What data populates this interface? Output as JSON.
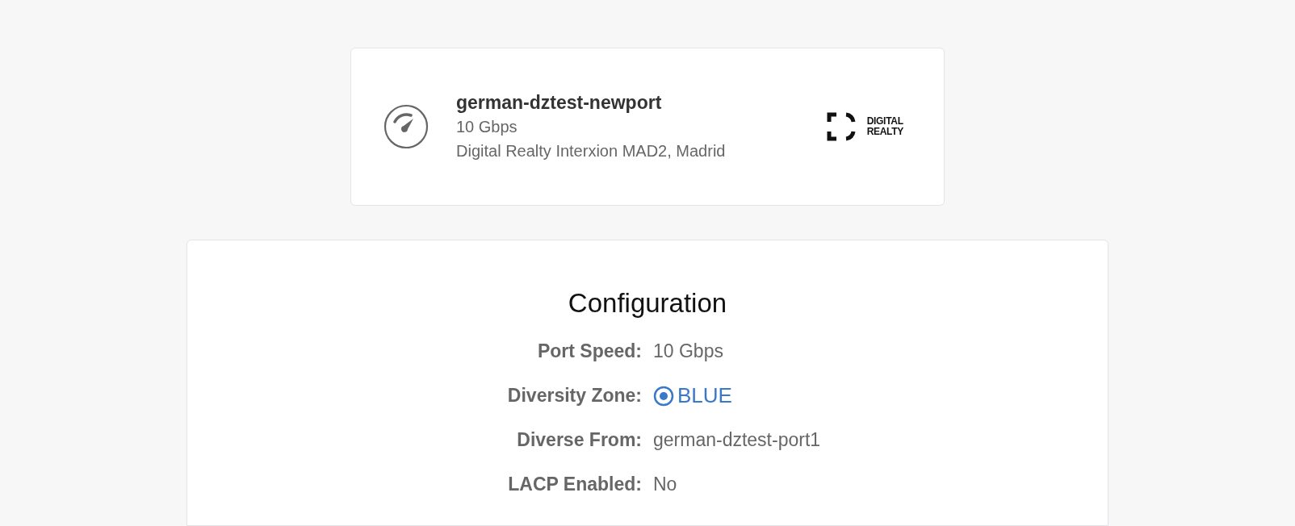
{
  "port_card": {
    "name": "german-dztest-newport",
    "speed": "10 Gbps",
    "location": "Digital Realty Interxion MAD2, Madrid",
    "logo_text": [
      "DIGITAL",
      "REALTY"
    ]
  },
  "configuration": {
    "title": "Configuration",
    "rows": [
      {
        "kind": "text",
        "label": "Port Speed:",
        "value": "10 Gbps"
      },
      {
        "kind": "zone",
        "label": "Diversity Zone:",
        "value": "BLUE",
        "color": "#3a78c9"
      },
      {
        "kind": "text",
        "label": "Diverse From:",
        "value": "german-dztest-port1"
      },
      {
        "kind": "text",
        "label": "LACP Enabled:",
        "value": "No"
      }
    ]
  }
}
